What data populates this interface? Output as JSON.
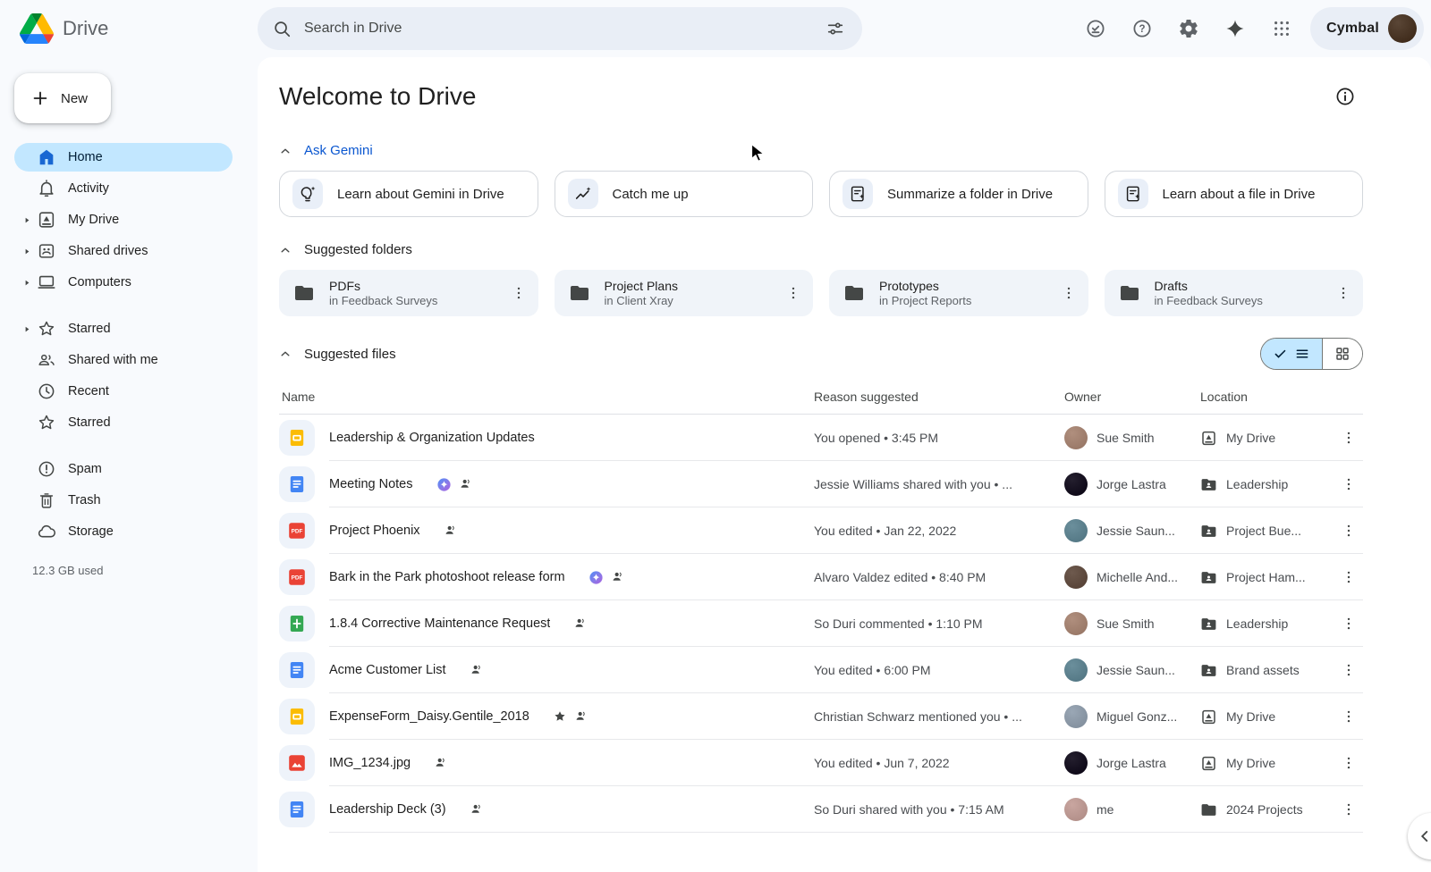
{
  "topbar": {
    "app_name": "Drive",
    "search_placeholder": "Search in Drive",
    "account_label": "Cymbal",
    "account_avatar_color": "#5a4636",
    "icon_buttons": [
      "offline-check",
      "help",
      "settings",
      "gemini-spark",
      "apps-grid"
    ]
  },
  "sidebar": {
    "new_label": "New",
    "groups": [
      [
        {
          "label": "Home",
          "icon": "home",
          "active": true
        },
        {
          "label": "Activity",
          "icon": "bell"
        },
        {
          "label": "My Drive",
          "icon": "mydrive",
          "expand": true
        },
        {
          "label": "Shared drives",
          "icon": "shared-drive",
          "expand": true
        },
        {
          "label": "Computers",
          "icon": "computer",
          "expand": true
        }
      ],
      [
        {
          "label": "Starred",
          "icon": "star",
          "expand": true
        },
        {
          "label": "Shared with me",
          "icon": "people"
        },
        {
          "label": "Recent",
          "icon": "clock"
        },
        {
          "label": "Starred",
          "icon": "star"
        }
      ],
      [
        {
          "label": "Spam",
          "icon": "spam"
        },
        {
          "label": "Trash",
          "icon": "trash"
        },
        {
          "label": "Storage",
          "icon": "cloud"
        }
      ]
    ],
    "storage_used": "12.3 GB used"
  },
  "main": {
    "title": "Welcome to Drive",
    "ask_gemini": {
      "label": "Ask Gemini",
      "cards": [
        {
          "label": "Learn about Gemini in Drive",
          "icon": "bulb-spark"
        },
        {
          "label": "Catch me up",
          "icon": "trend-spark"
        },
        {
          "label": "Summarize a folder in Drive",
          "icon": "doc-spark"
        },
        {
          "label": "Learn about a file in Drive",
          "icon": "doc-spark"
        }
      ]
    },
    "suggested_folders": {
      "label": "Suggested folders",
      "cards": [
        {
          "name": "PDFs",
          "location": "in Feedback Surveys"
        },
        {
          "name": "Project Plans",
          "location": "in Client Xray"
        },
        {
          "name": "Prototypes",
          "location": "in Project Reports"
        },
        {
          "name": "Drafts",
          "location": "in Feedback Surveys"
        }
      ]
    },
    "suggested_files": {
      "label": "Suggested files",
      "columns": [
        "Name",
        "Reason suggested",
        "Owner",
        "Location"
      ],
      "rows": [
        {
          "name": "Leadership & Organization Updates",
          "type": "slides",
          "gemini": false,
          "shared": false,
          "starred": false,
          "reason": "You opened • 3:45 PM",
          "owner": "Sue Smith",
          "avatar": "#b08f7e",
          "location": "My Drive",
          "location_icon": "mydrive"
        },
        {
          "name": "Meeting Notes",
          "type": "docs",
          "gemini": true,
          "shared": true,
          "starred": false,
          "reason": "Jessie Williams shared with you • ...",
          "owner": "Jorge Lastra",
          "avatar": "#241f2e",
          "location": "Leadership",
          "location_icon": "shared-folder"
        },
        {
          "name": "Project Phoenix",
          "type": "pdf",
          "gemini": false,
          "shared": true,
          "starred": false,
          "reason": "You edited • Jan 22, 2022",
          "owner": "Jessie Saun...",
          "avatar": "#6b8f9c",
          "location": "Project Bue...",
          "location_icon": "shared-folder"
        },
        {
          "name": "Bark in the Park photoshoot release form",
          "type": "pdf",
          "gemini": true,
          "shared": true,
          "starred": false,
          "reason": "Alvaro Valdez edited • 8:40 PM",
          "owner": "Michelle And...",
          "avatar": "#6e5a4e",
          "location": "Project Ham...",
          "location_icon": "shared-folder"
        },
        {
          "name": "1.8.4 Corrective Maintenance Request",
          "type": "sheets",
          "gemini": false,
          "shared": true,
          "starred": false,
          "reason": "So Duri commented • 1:10 PM",
          "owner": "Sue Smith",
          "avatar": "#b08f7e",
          "location": "Leadership",
          "location_icon": "shared-folder"
        },
        {
          "name": "Acme Customer List",
          "type": "docs",
          "gemini": false,
          "shared": true,
          "starred": false,
          "reason": "You edited • 6:00 PM",
          "owner": "Jessie Saun...",
          "avatar": "#6b8f9c",
          "location": "Brand assets",
          "location_icon": "shared-folder"
        },
        {
          "name": "ExpenseForm_Daisy.Gentile_2018",
          "type": "slides",
          "gemini": false,
          "shared": true,
          "starred": true,
          "reason": "Christian Schwarz mentioned you • ...",
          "owner": "Miguel Gonz...",
          "avatar": "#9aa7b5",
          "location": "My Drive",
          "location_icon": "mydrive"
        },
        {
          "name": "IMG_1234.jpg",
          "type": "image",
          "gemini": false,
          "shared": true,
          "starred": false,
          "reason": "You edited • Jun 7, 2022",
          "owner": "Jorge Lastra",
          "avatar": "#241f2e",
          "location": "My Drive",
          "location_icon": "mydrive"
        },
        {
          "name": "Leadership Deck (3)",
          "type": "docs",
          "gemini": false,
          "shared": true,
          "starred": false,
          "reason": "So Duri shared with you • 7:15 AM",
          "owner": "me",
          "avatar": "#c9a6a0",
          "location": "2024 Projects",
          "location_icon": "folder"
        }
      ]
    }
  },
  "colors": {
    "accent_blue": "#0b57d0",
    "selected_pill": "#c2e7ff",
    "docs": "#4285f4",
    "slides": "#fbbc04",
    "sheets": "#34a853",
    "pdf": "#ea4335",
    "image": "#ea4335",
    "search_bg": "#e9eef6"
  }
}
